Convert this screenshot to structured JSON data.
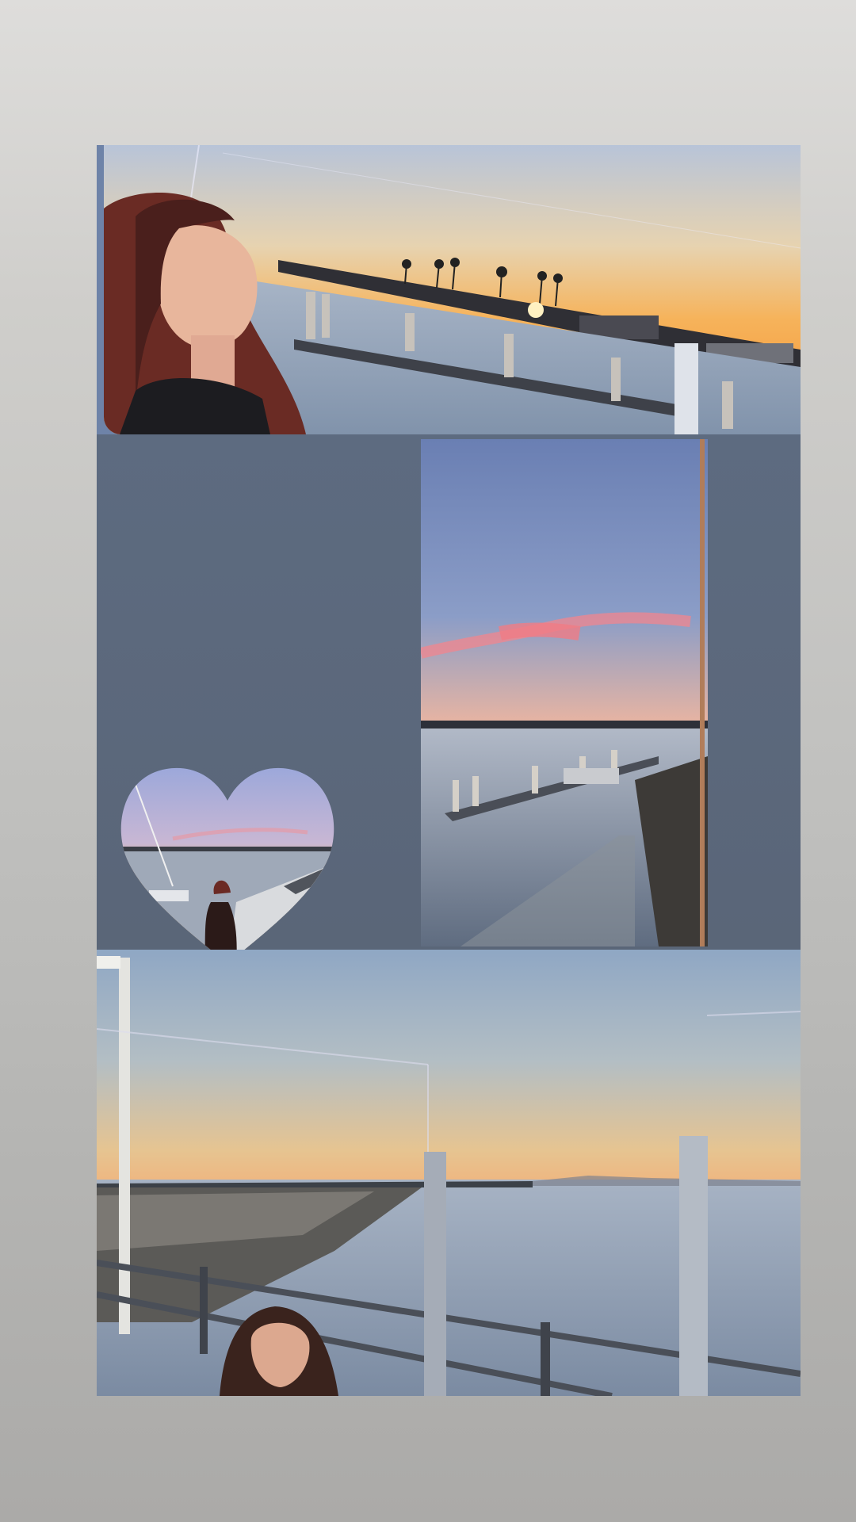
{
  "story": {
    "background_top": "#dedddb",
    "background_bottom": "#abaaa8",
    "panels": [
      {
        "id": "top-photo",
        "subject": "woman-at-sunset-marina"
      },
      {
        "id": "heart-photo",
        "subject": "harbor-walkway-heart-cutout"
      },
      {
        "id": "tall-photo",
        "subject": "harbor-channel-at-dusk"
      },
      {
        "id": "bottom-photo",
        "subject": "breakwater-ocean-sunset"
      }
    ],
    "colors": {
      "slate": "#5d6b80",
      "sky_blue": "#7f93bd",
      "sunset_orange": "#f5a44a",
      "water": "#8d9db1"
    }
  }
}
